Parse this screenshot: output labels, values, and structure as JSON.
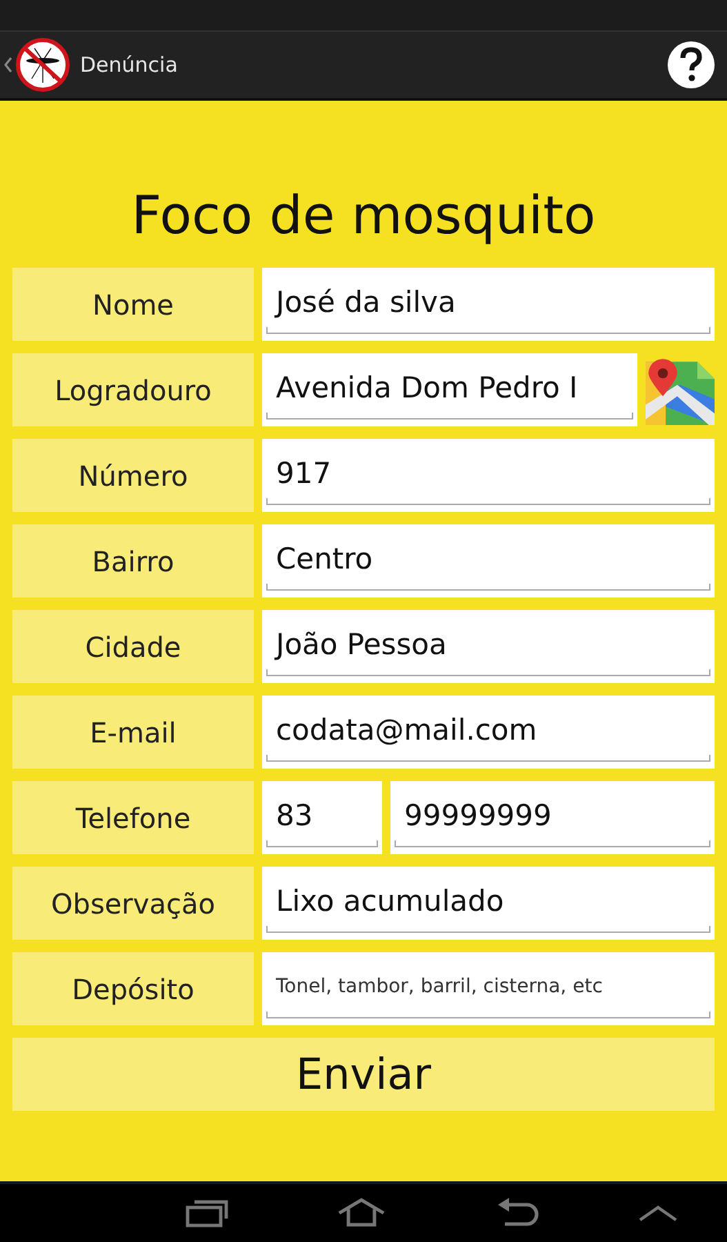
{
  "action_bar": {
    "title": "Denúncia"
  },
  "form": {
    "title": "Foco de mosquito",
    "rows": [
      {
        "kind": "text",
        "label": "Nome",
        "value": "José da silva"
      },
      {
        "kind": "map",
        "label": "Logradouro",
        "value": "Avenida Dom Pedro I"
      },
      {
        "kind": "text",
        "label": "Número",
        "value": "917"
      },
      {
        "kind": "text",
        "label": "Bairro",
        "value": "Centro"
      },
      {
        "kind": "text",
        "label": "Cidade",
        "value": "João Pessoa"
      },
      {
        "kind": "text",
        "label": "E-mail",
        "value": "codata@mail.com"
      },
      {
        "kind": "phone",
        "label": "Telefone",
        "area_code": "83",
        "number": "99999999"
      },
      {
        "kind": "text",
        "label": "Observação",
        "value": "Lixo acumulado"
      },
      {
        "kind": "text",
        "label": "Depósito",
        "placeholder": "Tonel, tambor, barril, cisterna, etc"
      }
    ],
    "submit": "Enviar"
  }
}
